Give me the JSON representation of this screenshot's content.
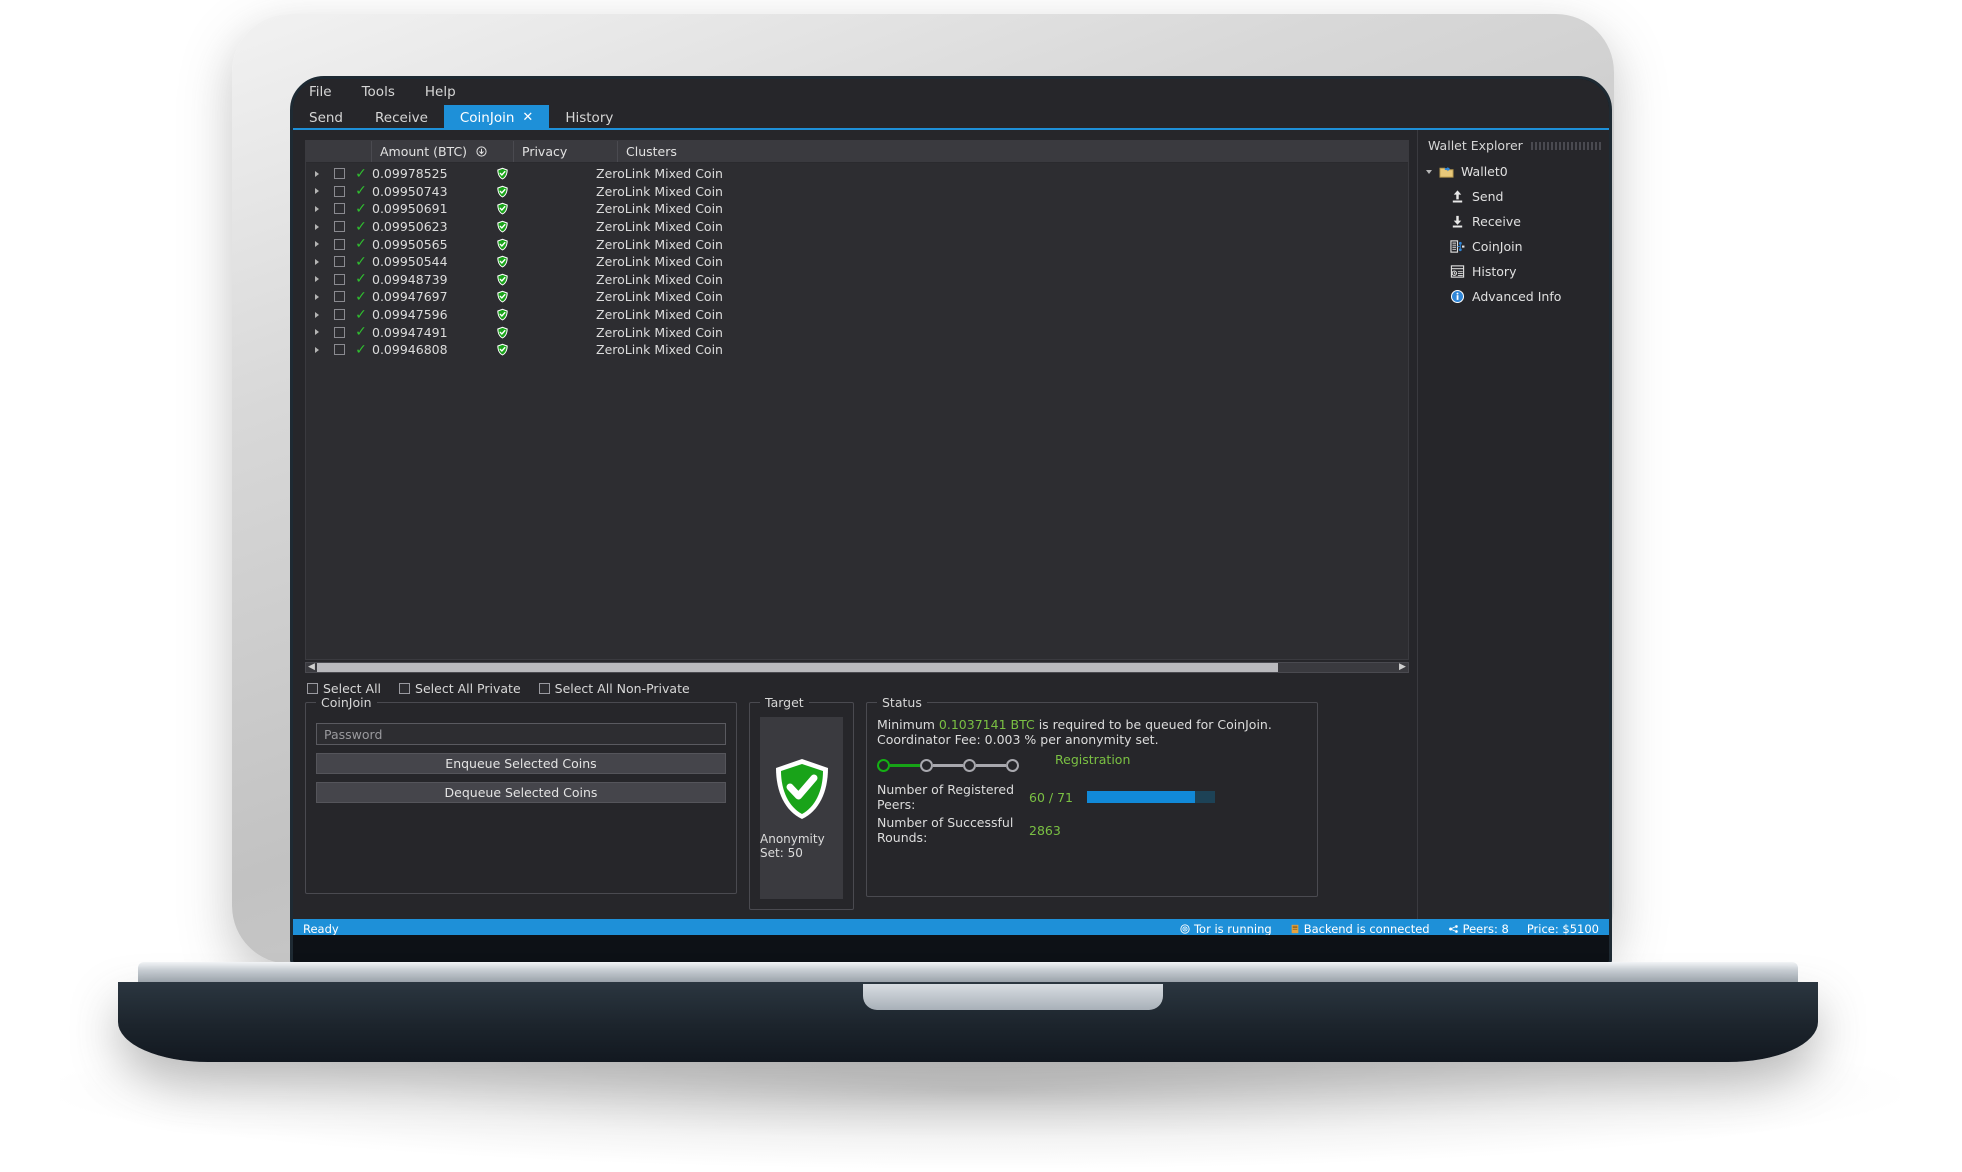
{
  "app": {
    "menu": [
      "File",
      "Tools",
      "Help"
    ],
    "tabs": [
      {
        "label": "Send",
        "active": false,
        "closable": false
      },
      {
        "label": "Receive",
        "active": false,
        "closable": false
      },
      {
        "label": "CoinJoin",
        "active": true,
        "closable": true,
        "close_glyph": "✕"
      },
      {
        "label": "History",
        "active": false,
        "closable": false
      }
    ]
  },
  "coin_list": {
    "columns": [
      "Amount (BTC)",
      "Privacy",
      "Clusters"
    ],
    "sort_icon": "sort-descending-icon",
    "rows": [
      {
        "amount": "0.09978525",
        "cluster": "ZeroLink Mixed Coin"
      },
      {
        "amount": "0.09950743",
        "cluster": "ZeroLink Mixed Coin"
      },
      {
        "amount": "0.09950691",
        "cluster": "ZeroLink Mixed Coin"
      },
      {
        "amount": "0.09950623",
        "cluster": "ZeroLink Mixed Coin"
      },
      {
        "amount": "0.09950565",
        "cluster": "ZeroLink Mixed Coin"
      },
      {
        "amount": "0.09950544",
        "cluster": "ZeroLink Mixed Coin"
      },
      {
        "amount": "0.09948739",
        "cluster": "ZeroLink Mixed Coin"
      },
      {
        "amount": "0.09947697",
        "cluster": "ZeroLink Mixed Coin"
      },
      {
        "amount": "0.09947596",
        "cluster": "ZeroLink Mixed Coin"
      },
      {
        "amount": "0.09947491",
        "cluster": "ZeroLink Mixed Coin"
      },
      {
        "amount": "0.09946808",
        "cluster": "ZeroLink Mixed Coin"
      }
    ]
  },
  "select_all": [
    {
      "label": "Select All",
      "checked": false
    },
    {
      "label": "Select All Private",
      "checked": false
    },
    {
      "label": "Select All Non-Private",
      "checked": false
    }
  ],
  "coinjoin_panel": {
    "title": "CoinJoin",
    "password_placeholder": "Password",
    "password_value": "",
    "enqueue_label": "Enqueue Selected Coins",
    "dequeue_label": "Dequeue Selected Coins"
  },
  "target_panel": {
    "title": "Target",
    "shield_icon": "shield-check-icon",
    "anonymity_label": "Anonymity Set: 50"
  },
  "status_panel": {
    "title": "Status",
    "minimum_prefix": "Minimum",
    "minimum_amount": "0.1037141 BTC",
    "minimum_suffix": "is required to be queued for CoinJoin.",
    "fee_line": "Coordinator Fee: 0.003 % per anonymity set.",
    "phase": "Registration",
    "phase_step": 1,
    "total_steps": 4,
    "peers_label": "Number of Registered Peers:",
    "peers_value": "60 / 71",
    "peers_percent": 84,
    "rounds_label": "Number of Successful Rounds:",
    "rounds_value": "2863"
  },
  "sidebar": {
    "title": "Wallet Explorer",
    "root": {
      "label": "Wallet0",
      "icon": "folder-wallet-icon"
    },
    "items": [
      {
        "label": "Send",
        "icon": "arrow-up-send-icon"
      },
      {
        "label": "Receive",
        "icon": "arrow-down-receive-icon"
      },
      {
        "label": "CoinJoin",
        "icon": "coinjoin-grid-icon"
      },
      {
        "label": "History",
        "icon": "history-list-icon"
      },
      {
        "label": "Advanced Info",
        "icon": "info-circle-icon"
      }
    ]
  },
  "statusbar": {
    "ready": "Ready",
    "tor": "Tor is running",
    "tor_icon": "tor-onion-icon",
    "backend": "Backend is connected",
    "backend_icon": "server-icon",
    "peers": "Peers: 8",
    "peers_icon": "peers-icon",
    "price": "Price: $5100"
  },
  "colors": {
    "accent_blue": "#1e90d8",
    "green": "#7ac043",
    "check_green": "#2fbf2f",
    "panel_bg": "#2d2d31",
    "window_bg": "#26262a"
  }
}
